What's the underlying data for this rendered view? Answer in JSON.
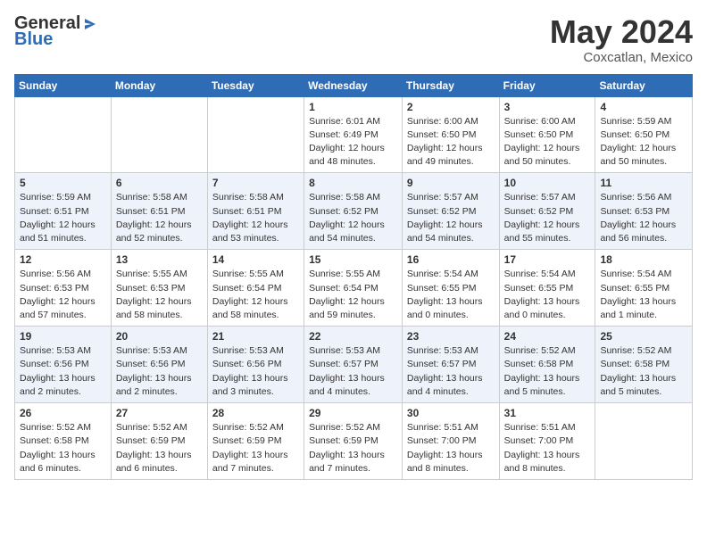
{
  "header": {
    "logo_general": "General",
    "logo_blue": "Blue",
    "month": "May 2024",
    "location": "Coxcatlan, Mexico"
  },
  "weekdays": [
    "Sunday",
    "Monday",
    "Tuesday",
    "Wednesday",
    "Thursday",
    "Friday",
    "Saturday"
  ],
  "weeks": [
    [
      {
        "day": "",
        "info": ""
      },
      {
        "day": "",
        "info": ""
      },
      {
        "day": "",
        "info": ""
      },
      {
        "day": "1",
        "info": "Sunrise: 6:01 AM\nSunset: 6:49 PM\nDaylight: 12 hours\nand 48 minutes."
      },
      {
        "day": "2",
        "info": "Sunrise: 6:00 AM\nSunset: 6:50 PM\nDaylight: 12 hours\nand 49 minutes."
      },
      {
        "day": "3",
        "info": "Sunrise: 6:00 AM\nSunset: 6:50 PM\nDaylight: 12 hours\nand 50 minutes."
      },
      {
        "day": "4",
        "info": "Sunrise: 5:59 AM\nSunset: 6:50 PM\nDaylight: 12 hours\nand 50 minutes."
      }
    ],
    [
      {
        "day": "5",
        "info": "Sunrise: 5:59 AM\nSunset: 6:51 PM\nDaylight: 12 hours\nand 51 minutes."
      },
      {
        "day": "6",
        "info": "Sunrise: 5:58 AM\nSunset: 6:51 PM\nDaylight: 12 hours\nand 52 minutes."
      },
      {
        "day": "7",
        "info": "Sunrise: 5:58 AM\nSunset: 6:51 PM\nDaylight: 12 hours\nand 53 minutes."
      },
      {
        "day": "8",
        "info": "Sunrise: 5:58 AM\nSunset: 6:52 PM\nDaylight: 12 hours\nand 54 minutes."
      },
      {
        "day": "9",
        "info": "Sunrise: 5:57 AM\nSunset: 6:52 PM\nDaylight: 12 hours\nand 54 minutes."
      },
      {
        "day": "10",
        "info": "Sunrise: 5:57 AM\nSunset: 6:52 PM\nDaylight: 12 hours\nand 55 minutes."
      },
      {
        "day": "11",
        "info": "Sunrise: 5:56 AM\nSunset: 6:53 PM\nDaylight: 12 hours\nand 56 minutes."
      }
    ],
    [
      {
        "day": "12",
        "info": "Sunrise: 5:56 AM\nSunset: 6:53 PM\nDaylight: 12 hours\nand 57 minutes."
      },
      {
        "day": "13",
        "info": "Sunrise: 5:55 AM\nSunset: 6:53 PM\nDaylight: 12 hours\nand 58 minutes."
      },
      {
        "day": "14",
        "info": "Sunrise: 5:55 AM\nSunset: 6:54 PM\nDaylight: 12 hours\nand 58 minutes."
      },
      {
        "day": "15",
        "info": "Sunrise: 5:55 AM\nSunset: 6:54 PM\nDaylight: 12 hours\nand 59 minutes."
      },
      {
        "day": "16",
        "info": "Sunrise: 5:54 AM\nSunset: 6:55 PM\nDaylight: 13 hours\nand 0 minutes."
      },
      {
        "day": "17",
        "info": "Sunrise: 5:54 AM\nSunset: 6:55 PM\nDaylight: 13 hours\nand 0 minutes."
      },
      {
        "day": "18",
        "info": "Sunrise: 5:54 AM\nSunset: 6:55 PM\nDaylight: 13 hours\nand 1 minute."
      }
    ],
    [
      {
        "day": "19",
        "info": "Sunrise: 5:53 AM\nSunset: 6:56 PM\nDaylight: 13 hours\nand 2 minutes."
      },
      {
        "day": "20",
        "info": "Sunrise: 5:53 AM\nSunset: 6:56 PM\nDaylight: 13 hours\nand 2 minutes."
      },
      {
        "day": "21",
        "info": "Sunrise: 5:53 AM\nSunset: 6:56 PM\nDaylight: 13 hours\nand 3 minutes."
      },
      {
        "day": "22",
        "info": "Sunrise: 5:53 AM\nSunset: 6:57 PM\nDaylight: 13 hours\nand 4 minutes."
      },
      {
        "day": "23",
        "info": "Sunrise: 5:53 AM\nSunset: 6:57 PM\nDaylight: 13 hours\nand 4 minutes."
      },
      {
        "day": "24",
        "info": "Sunrise: 5:52 AM\nSunset: 6:58 PM\nDaylight: 13 hours\nand 5 minutes."
      },
      {
        "day": "25",
        "info": "Sunrise: 5:52 AM\nSunset: 6:58 PM\nDaylight: 13 hours\nand 5 minutes."
      }
    ],
    [
      {
        "day": "26",
        "info": "Sunrise: 5:52 AM\nSunset: 6:58 PM\nDaylight: 13 hours\nand 6 minutes."
      },
      {
        "day": "27",
        "info": "Sunrise: 5:52 AM\nSunset: 6:59 PM\nDaylight: 13 hours\nand 6 minutes."
      },
      {
        "day": "28",
        "info": "Sunrise: 5:52 AM\nSunset: 6:59 PM\nDaylight: 13 hours\nand 7 minutes."
      },
      {
        "day": "29",
        "info": "Sunrise: 5:52 AM\nSunset: 6:59 PM\nDaylight: 13 hours\nand 7 minutes."
      },
      {
        "day": "30",
        "info": "Sunrise: 5:51 AM\nSunset: 7:00 PM\nDaylight: 13 hours\nand 8 minutes."
      },
      {
        "day": "31",
        "info": "Sunrise: 5:51 AM\nSunset: 7:00 PM\nDaylight: 13 hours\nand 8 minutes."
      },
      {
        "day": "",
        "info": ""
      }
    ]
  ]
}
